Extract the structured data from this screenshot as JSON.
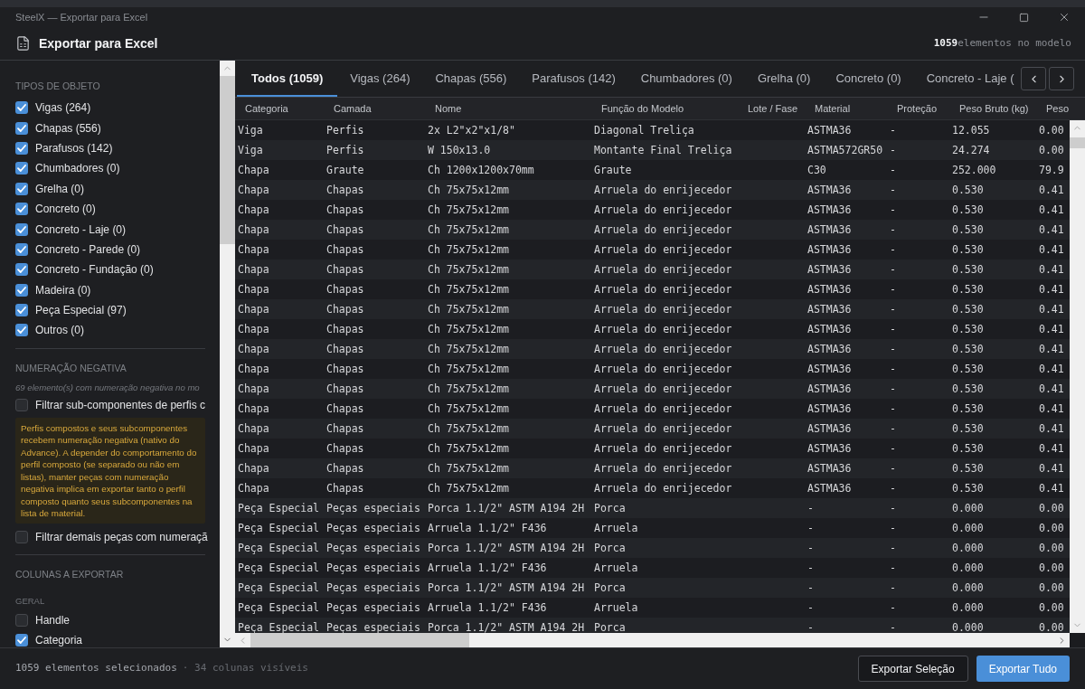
{
  "window": {
    "title": "SteelX — Exportar para Excel"
  },
  "header": {
    "title": "Exportar para Excel",
    "count": "1059",
    "count_label": "elementos no modelo"
  },
  "sidebar": {
    "sections": [
      {
        "heading": "TIPOS DE OBJETO",
        "items": [
          {
            "kind": "checkbox",
            "label": "Vigas (264)",
            "checked": true
          },
          {
            "kind": "checkbox",
            "label": "Chapas (556)",
            "checked": true
          },
          {
            "kind": "checkbox",
            "label": "Parafusos (142)",
            "checked": true
          },
          {
            "kind": "checkbox",
            "label": "Chumbadores (0)",
            "checked": true
          },
          {
            "kind": "checkbox",
            "label": "Grelha (0)",
            "checked": true
          },
          {
            "kind": "checkbox",
            "label": "Concreto (0)",
            "checked": true
          },
          {
            "kind": "checkbox",
            "label": "Concreto - Laje (0)",
            "checked": true
          },
          {
            "kind": "checkbox",
            "label": "Concreto - Parede (0)",
            "checked": true
          },
          {
            "kind": "checkbox",
            "label": "Concreto - Fundação (0)",
            "checked": true
          },
          {
            "kind": "checkbox",
            "label": "Madeira (0)",
            "checked": true
          },
          {
            "kind": "checkbox",
            "label": "Peça Especial (97)",
            "checked": true
          },
          {
            "kind": "checkbox",
            "label": "Outros (0)",
            "checked": true
          }
        ]
      },
      {
        "heading": "NUMERAÇÃO NEGATIVA",
        "items": [
          {
            "kind": "note",
            "text": "69 elemento(s) com numeração negativa no mo"
          },
          {
            "kind": "checkbox",
            "label": "Filtrar sub-componentes de perfis c",
            "checked": false
          },
          {
            "kind": "warning",
            "text": "Perfis compostos e seus subcomponentes recebem numeração negativa (nativo do Advance). A depender do comportamento do perfil composto (se separado ou não em listas), manter peças com numeração negativa implica em exportar tanto o perfil composto quanto seus subcomponentes na lista de material."
          },
          {
            "kind": "checkbox",
            "label": "Filtrar demais peças com numeraçã",
            "checked": false
          }
        ]
      },
      {
        "heading": "COLUNAS A EXPORTAR",
        "items": [
          {
            "kind": "subheading",
            "text": "GERAL"
          },
          {
            "kind": "checkbox",
            "label": "Handle",
            "checked": false
          },
          {
            "kind": "checkbox",
            "label": "Categoria",
            "checked": true
          }
        ]
      }
    ]
  },
  "tabs": [
    {
      "label": "Todos (1059)",
      "selected": true
    },
    {
      "label": "Vigas (264)",
      "selected": false
    },
    {
      "label": "Chapas (556)",
      "selected": false
    },
    {
      "label": "Parafusos (142)",
      "selected": false
    },
    {
      "label": "Chumbadores (0)",
      "selected": false
    },
    {
      "label": "Grelha (0)",
      "selected": false
    },
    {
      "label": "Concreto (0)",
      "selected": false
    },
    {
      "label": "Concreto - Laje (",
      "selected": false
    }
  ],
  "table": {
    "columns": [
      "Categoria",
      "Camada",
      "Nome",
      "Função do Modelo",
      "Lote / Fase",
      "Material",
      "Proteção",
      "Peso Bruto (kg)",
      "Peso"
    ],
    "rows": [
      {
        "categoria": "Viga",
        "camada": "Perfis",
        "nome": "2x L2\"x2\"x1/8\"",
        "funcao_do_modelo": "Diagonal Treliça",
        "material": "ASTMA36",
        "protecao": "-",
        "peso_bruto_kg": "12.055",
        "peso": "0.00"
      },
      {
        "categoria": "Viga",
        "camada": "Perfis",
        "nome": "W 150x13.0",
        "funcao_do_modelo": "Montante Final Treliça",
        "material": "ASTMA572GR50",
        "protecao": "-",
        "peso_bruto_kg": "24.274",
        "peso": "0.00"
      },
      {
        "categoria": "Chapa",
        "camada": "Graute",
        "nome": "Ch 1200x1200x70mm",
        "funcao_do_modelo": "Graute",
        "material": "C30",
        "protecao": "-",
        "peso_bruto_kg": "252.000",
        "peso": "79.9"
      },
      {
        "categoria": "Chapa",
        "camada": "Chapas",
        "nome": "Ch 75x75x12mm",
        "funcao_do_modelo": "Arruela do enrijecedor",
        "material": "ASTMA36",
        "protecao": "-",
        "peso_bruto_kg": "0.530",
        "peso": "0.41"
      },
      {
        "categoria": "Chapa",
        "camada": "Chapas",
        "nome": "Ch 75x75x12mm",
        "funcao_do_modelo": "Arruela do enrijecedor",
        "material": "ASTMA36",
        "protecao": "-",
        "peso_bruto_kg": "0.530",
        "peso": "0.41"
      },
      {
        "categoria": "Chapa",
        "camada": "Chapas",
        "nome": "Ch 75x75x12mm",
        "funcao_do_modelo": "Arruela do enrijecedor",
        "material": "ASTMA36",
        "protecao": "-",
        "peso_bruto_kg": "0.530",
        "peso": "0.41"
      },
      {
        "categoria": "Chapa",
        "camada": "Chapas",
        "nome": "Ch 75x75x12mm",
        "funcao_do_modelo": "Arruela do enrijecedor",
        "material": "ASTMA36",
        "protecao": "-",
        "peso_bruto_kg": "0.530",
        "peso": "0.41"
      },
      {
        "categoria": "Chapa",
        "camada": "Chapas",
        "nome": "Ch 75x75x12mm",
        "funcao_do_modelo": "Arruela do enrijecedor",
        "material": "ASTMA36",
        "protecao": "-",
        "peso_bruto_kg": "0.530",
        "peso": "0.41"
      },
      {
        "categoria": "Chapa",
        "camada": "Chapas",
        "nome": "Ch 75x75x12mm",
        "funcao_do_modelo": "Arruela do enrijecedor",
        "material": "ASTMA36",
        "protecao": "-",
        "peso_bruto_kg": "0.530",
        "peso": "0.41"
      },
      {
        "categoria": "Chapa",
        "camada": "Chapas",
        "nome": "Ch 75x75x12mm",
        "funcao_do_modelo": "Arruela do enrijecedor",
        "material": "ASTMA36",
        "protecao": "-",
        "peso_bruto_kg": "0.530",
        "peso": "0.41"
      },
      {
        "categoria": "Chapa",
        "camada": "Chapas",
        "nome": "Ch 75x75x12mm",
        "funcao_do_modelo": "Arruela do enrijecedor",
        "material": "ASTMA36",
        "protecao": "-",
        "peso_bruto_kg": "0.530",
        "peso": "0.41"
      },
      {
        "categoria": "Chapa",
        "camada": "Chapas",
        "nome": "Ch 75x75x12mm",
        "funcao_do_modelo": "Arruela do enrijecedor",
        "material": "ASTMA36",
        "protecao": "-",
        "peso_bruto_kg": "0.530",
        "peso": "0.41"
      },
      {
        "categoria": "Chapa",
        "camada": "Chapas",
        "nome": "Ch 75x75x12mm",
        "funcao_do_modelo": "Arruela do enrijecedor",
        "material": "ASTMA36",
        "protecao": "-",
        "peso_bruto_kg": "0.530",
        "peso": "0.41"
      },
      {
        "categoria": "Chapa",
        "camada": "Chapas",
        "nome": "Ch 75x75x12mm",
        "funcao_do_modelo": "Arruela do enrijecedor",
        "material": "ASTMA36",
        "protecao": "-",
        "peso_bruto_kg": "0.530",
        "peso": "0.41"
      },
      {
        "categoria": "Chapa",
        "camada": "Chapas",
        "nome": "Ch 75x75x12mm",
        "funcao_do_modelo": "Arruela do enrijecedor",
        "material": "ASTMA36",
        "protecao": "-",
        "peso_bruto_kg": "0.530",
        "peso": "0.41"
      },
      {
        "categoria": "Chapa",
        "camada": "Chapas",
        "nome": "Ch 75x75x12mm",
        "funcao_do_modelo": "Arruela do enrijecedor",
        "material": "ASTMA36",
        "protecao": "-",
        "peso_bruto_kg": "0.530",
        "peso": "0.41"
      },
      {
        "categoria": "Chapa",
        "camada": "Chapas",
        "nome": "Ch 75x75x12mm",
        "funcao_do_modelo": "Arruela do enrijecedor",
        "material": "ASTMA36",
        "protecao": "-",
        "peso_bruto_kg": "0.530",
        "peso": "0.41"
      },
      {
        "categoria": "Chapa",
        "camada": "Chapas",
        "nome": "Ch 75x75x12mm",
        "funcao_do_modelo": "Arruela do enrijecedor",
        "material": "ASTMA36",
        "protecao": "-",
        "peso_bruto_kg": "0.530",
        "peso": "0.41"
      },
      {
        "categoria": "Chapa",
        "camada": "Chapas",
        "nome": "Ch 75x75x12mm",
        "funcao_do_modelo": "Arruela do enrijecedor",
        "material": "ASTMA36",
        "protecao": "-",
        "peso_bruto_kg": "0.530",
        "peso": "0.41"
      },
      {
        "categoria": "Peça Especial",
        "camada": "Peças especiais",
        "nome": "Porca 1.1/2\" ASTM A194 2H",
        "funcao_do_modelo": "Porca",
        "material": "-",
        "protecao": "-",
        "peso_bruto_kg": "0.000",
        "peso": "0.00"
      },
      {
        "categoria": "Peça Especial",
        "camada": "Peças especiais",
        "nome": "Arruela 1.1/2\" F436",
        "funcao_do_modelo": "Arruela",
        "material": "-",
        "protecao": "-",
        "peso_bruto_kg": "0.000",
        "peso": "0.00"
      },
      {
        "categoria": "Peça Especial",
        "camada": "Peças especiais",
        "nome": "Porca 1.1/2\" ASTM A194 2H",
        "funcao_do_modelo": "Porca",
        "material": "-",
        "protecao": "-",
        "peso_bruto_kg": "0.000",
        "peso": "0.00"
      },
      {
        "categoria": "Peça Especial",
        "camada": "Peças especiais",
        "nome": "Arruela 1.1/2\" F436",
        "funcao_do_modelo": "Arruela",
        "material": "-",
        "protecao": "-",
        "peso_bruto_kg": "0.000",
        "peso": "0.00"
      },
      {
        "categoria": "Peça Especial",
        "camada": "Peças especiais",
        "nome": "Porca 1.1/2\" ASTM A194 2H",
        "funcao_do_modelo": "Porca",
        "material": "-",
        "protecao": "-",
        "peso_bruto_kg": "0.000",
        "peso": "0.00"
      },
      {
        "categoria": "Peça Especial",
        "camada": "Peças especiais",
        "nome": "Arruela 1.1/2\" F436",
        "funcao_do_modelo": "Arruela",
        "material": "-",
        "protecao": "-",
        "peso_bruto_kg": "0.000",
        "peso": "0.00"
      },
      {
        "categoria": "Peça Especial",
        "camada": "Peças especiais",
        "nome": "Porca 1.1/2\" ASTM A194 2H",
        "funcao_do_modelo": "Porca",
        "material": "-",
        "protecao": "-",
        "peso_bruto_kg": "0.000",
        "peso": "0.00"
      }
    ]
  },
  "footer": {
    "selection": "1059 elementos selecionados",
    "columns": "· 34 colunas visíveis",
    "buttons": [
      "Exportar Seleção",
      "Exportar Tudo"
    ]
  }
}
